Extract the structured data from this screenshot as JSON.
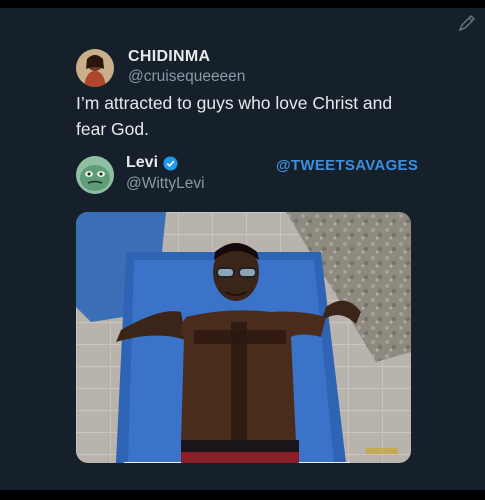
{
  "tweet": {
    "author_name": "CHIDINMA",
    "author_handle": "@cruisequeeeen",
    "text": "I’m attracted to guys who love Christ and fear God."
  },
  "reply": {
    "author_name": "Levi",
    "author_handle": "@WittyLevi",
    "verified": true,
    "watermark": "@TWEETSAVAGES"
  },
  "icons": {
    "edit": "pencil-icon",
    "verified": "verified-badge-icon"
  },
  "colors": {
    "background": "#15202b",
    "text_primary": "#e7e9ea",
    "text_secondary": "#8b98a5",
    "accent": "#1d9bf0",
    "watermark": "#3b8fe0"
  }
}
